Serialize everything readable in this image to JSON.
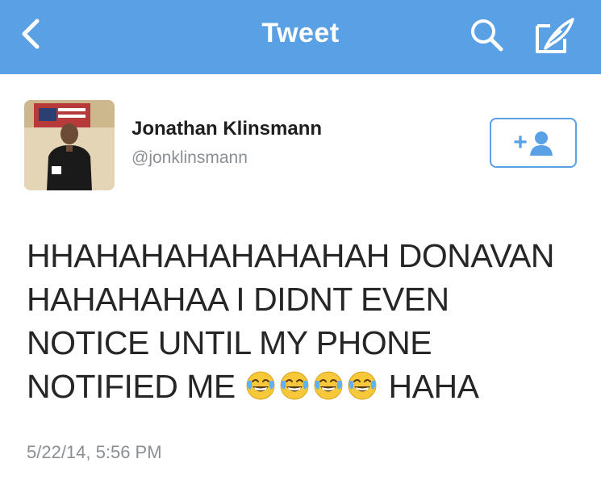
{
  "nav": {
    "title": "Tweet",
    "back_icon": "chevron-left-icon",
    "search_icon": "search-icon",
    "compose_icon": "compose-icon",
    "bar_color": "#5aa0e4"
  },
  "user": {
    "name": "Jonathan Klinsmann",
    "handle": "@jonklinsmann",
    "avatar_icon": "player-photo",
    "follow_button": {
      "label": "+",
      "icon": "person-icon"
    }
  },
  "tweet": {
    "lines": [
      "HHAHAHAHAHAHAHAH DONAVAN",
      "HAHAHAHAA I DIDNT EVEN",
      "NOTICE UNTIL MY PHONE",
      "NOTIFIED ME"
    ],
    "emoji": [
      "face-with-tears-of-joy",
      "face-with-tears-of-joy",
      "face-with-tears-of-joy",
      "face-with-tears-of-joy"
    ],
    "suffix": "HAHA",
    "timestamp": "5/22/14, 5:56 PM"
  }
}
